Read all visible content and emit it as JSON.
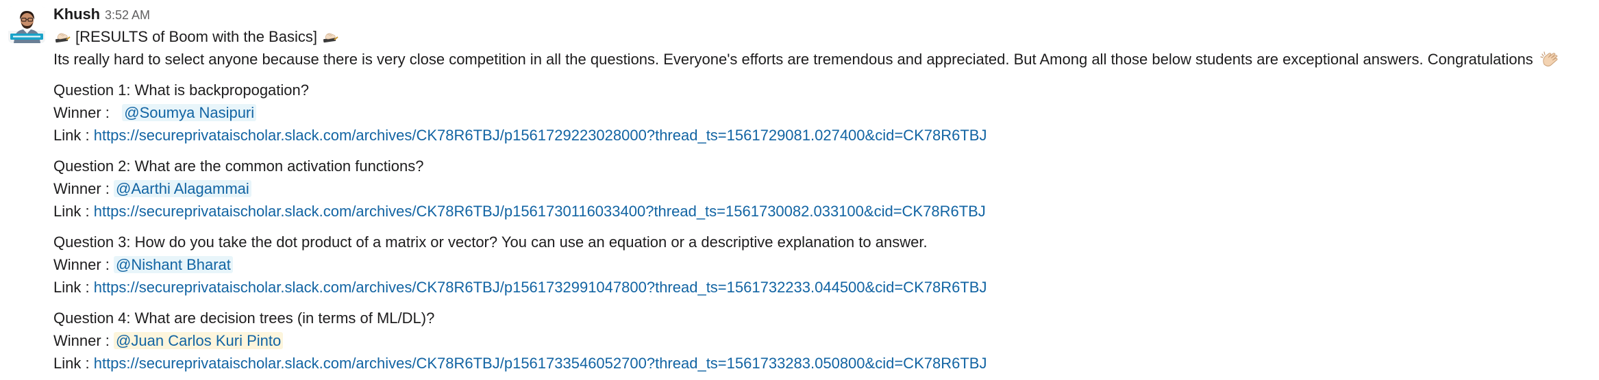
{
  "message": {
    "author": "Khush",
    "time": "3:52 AM",
    "avatar_icon": "user-avatar-photo",
    "title": "[RESULTS of Boom with the Basics]",
    "title_emoji_left": "writing-hand-emoji",
    "title_emoji_right": "writing-hand-emoji",
    "intro": "Its really hard to select anyone because there is very close competition in all the questions. Everyone's efforts are tremendous and appreciated. But Among all those below students are exceptional answers. Congratulations",
    "intro_emoji": "clapping-hands-emoji",
    "winner_label": "Winner :",
    "link_label": "Link :",
    "questions": [
      {
        "question": "Question 1:  What is backpropogation?",
        "winner": "@Soumya Nasipuri",
        "link": "https://secureprivataischolar.slack.com/archives/CK78R6TBJ/p1561729223028000?thread_ts=1561729081.027400&cid=CK78R6TBJ"
      },
      {
        "question": "Question 2: What are the common activation functions?",
        "winner": "@Aarthi Alagammai",
        "link": "https://secureprivataischolar.slack.com/archives/CK78R6TBJ/p1561730116033400?thread_ts=1561730082.033100&cid=CK78R6TBJ"
      },
      {
        "question": "Question 3: How do you take the dot product of a matrix or vector? You can use an equation or a descriptive explanation to answer.",
        "winner": "@Nishant Bharat",
        "link": "https://secureprivataischolar.slack.com/archives/CK78R6TBJ/p1561732991047800?thread_ts=1561732233.044500&cid=CK78R6TBJ"
      },
      {
        "question": "Question 4: What are decision trees (in terms of ML/DL)?",
        "winner": "@Juan Carlos Kuri Pinto",
        "link": "https://secureprivataischolar.slack.com/archives/CK78R6TBJ/p1561733546052700?thread_ts=1561733283.050800&cid=CK78R6TBJ"
      }
    ]
  },
  "colors": {
    "text": "#1d1c1d",
    "timestamp": "#616061",
    "link": "#1264a3",
    "mention_bg": "#e8f5fa",
    "mention_self_bg": "#fdf5dc"
  }
}
